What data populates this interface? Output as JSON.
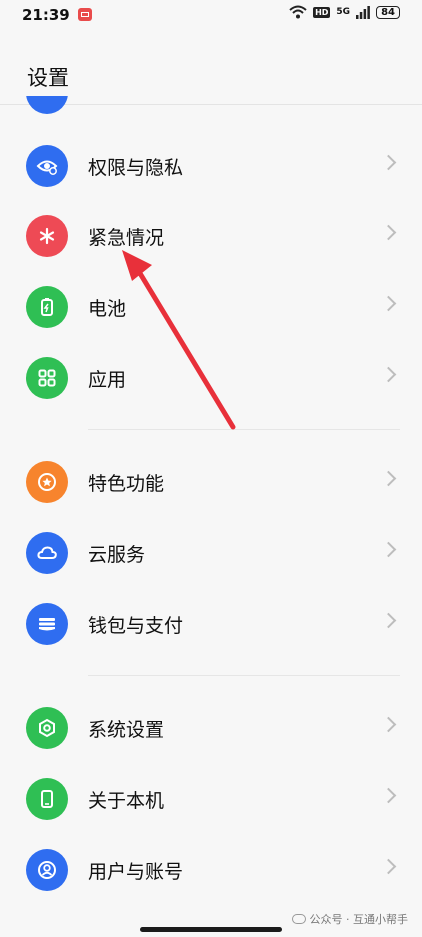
{
  "status_bar": {
    "time": "21:39",
    "network_badge": "HD",
    "signal_label": "5G",
    "battery": "84"
  },
  "header": {
    "title": "设置"
  },
  "items": [
    {
      "label": "权限与隐私",
      "icon": "privacy-eye-icon",
      "color": "#2f6df0"
    },
    {
      "label": "紧急情况",
      "icon": "emergency-asterisk-icon",
      "color": "#ee4a55"
    },
    {
      "label": "电池",
      "icon": "battery-icon",
      "color": "#2fbf54"
    },
    {
      "label": "应用",
      "icon": "apps-grid-icon",
      "color": "#2fbf54"
    },
    {
      "label": "特色功能",
      "icon": "star-circle-icon",
      "color": "#f7842d"
    },
    {
      "label": "云服务",
      "icon": "cloud-icon",
      "color": "#2f6df0"
    },
    {
      "label": "钱包与支付",
      "icon": "wallet-icon",
      "color": "#2f6df0"
    },
    {
      "label": "系统设置",
      "icon": "hexagon-gear-icon",
      "color": "#2fbf54"
    },
    {
      "label": "关于本机",
      "icon": "phone-icon",
      "color": "#2fbf54"
    },
    {
      "label": "用户与账号",
      "icon": "user-account-icon",
      "color": "#2f6df0"
    }
  ],
  "watermark": {
    "text": "公众号 · 互通小帮手"
  },
  "annotation": {
    "arrow_color": "#e8303a"
  }
}
